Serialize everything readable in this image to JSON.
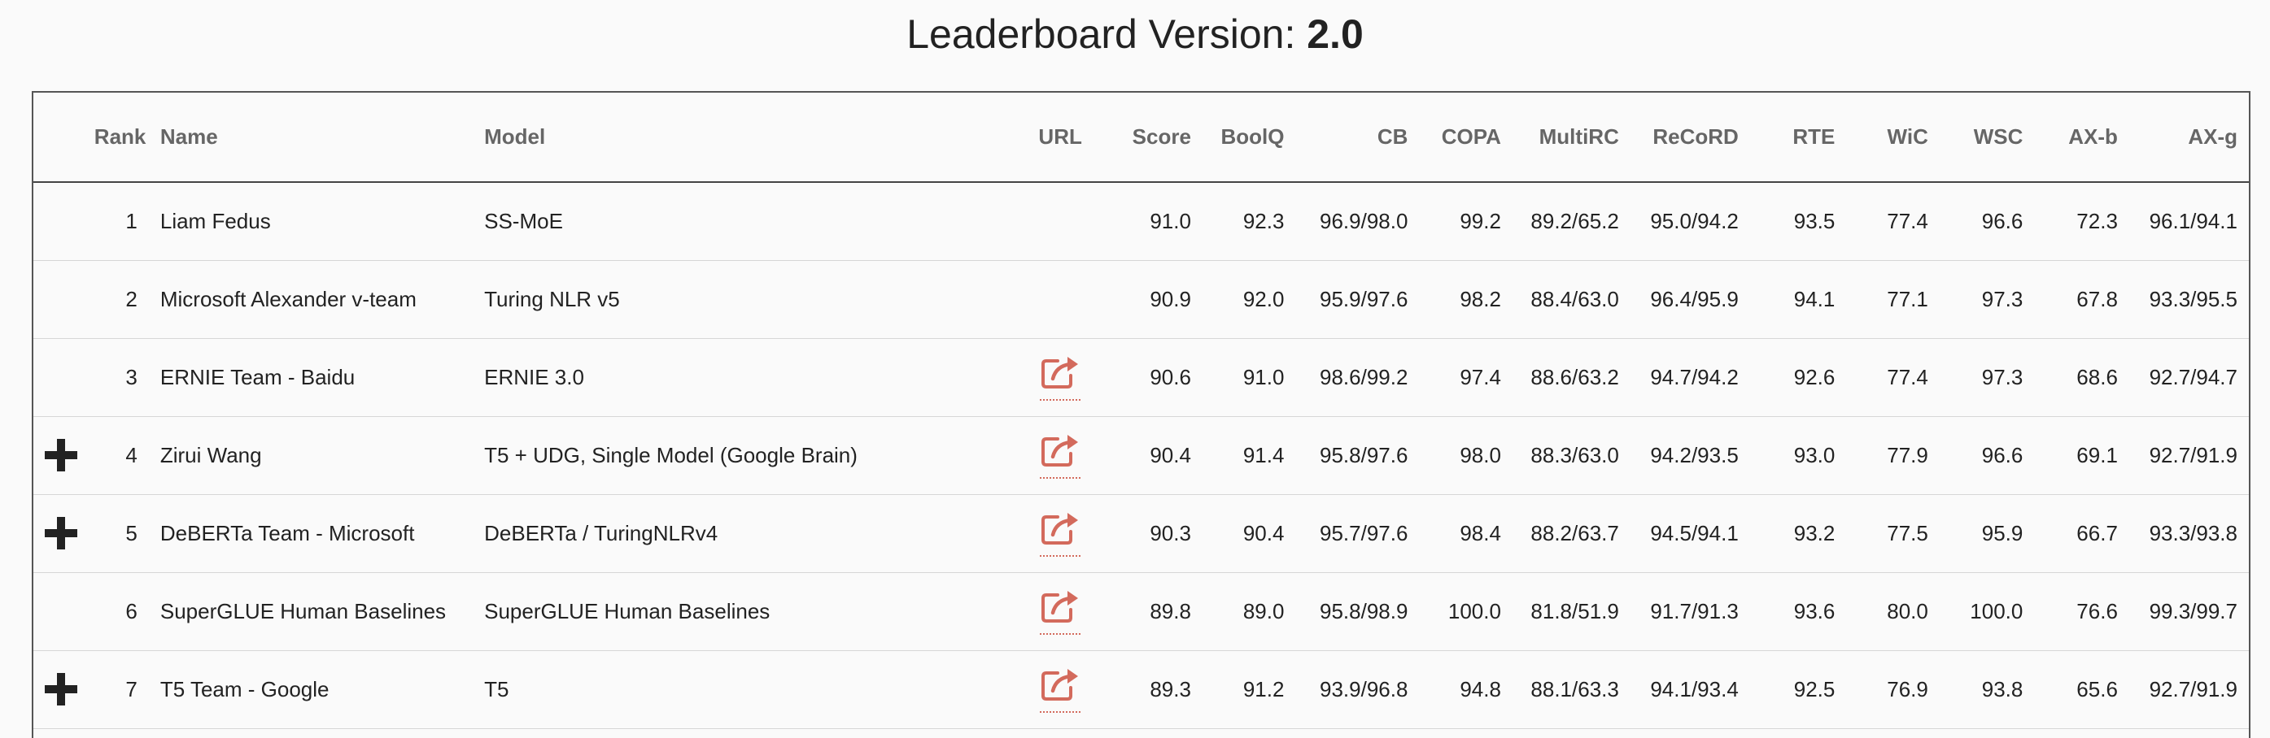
{
  "header": {
    "title_prefix": "Leaderboard Version: ",
    "version": "2.0"
  },
  "columns": {
    "rank": "Rank",
    "name": "Name",
    "model": "Model",
    "url": "URL",
    "score": "Score",
    "boolq": "BoolQ",
    "cb": "CB",
    "copa": "COPA",
    "multirc": "MultiRC",
    "record": "ReCoRD",
    "rte": "RTE",
    "wic": "WiC",
    "wsc": "WSC",
    "axb": "AX-b",
    "axg": "AX-g"
  },
  "rows": [
    {
      "expand": false,
      "rank": "1",
      "name": "Liam Fedus",
      "model": "SS-MoE",
      "has_url": false,
      "score": "91.0",
      "boolq": "92.3",
      "cb": "96.9/98.0",
      "copa": "99.2",
      "multirc": "89.2/65.2",
      "record": "95.0/94.2",
      "rte": "93.5",
      "wic": "77.4",
      "wsc": "96.6",
      "axb": "72.3",
      "axg": "96.1/94.1"
    },
    {
      "expand": false,
      "rank": "2",
      "name": "Microsoft Alexander v-team",
      "model": "Turing NLR v5",
      "has_url": false,
      "score": "90.9",
      "boolq": "92.0",
      "cb": "95.9/97.6",
      "copa": "98.2",
      "multirc": "88.4/63.0",
      "record": "96.4/95.9",
      "rte": "94.1",
      "wic": "77.1",
      "wsc": "97.3",
      "axb": "67.8",
      "axg": "93.3/95.5"
    },
    {
      "expand": false,
      "rank": "3",
      "name": "ERNIE Team - Baidu",
      "model": "ERNIE 3.0",
      "has_url": true,
      "score": "90.6",
      "boolq": "91.0",
      "cb": "98.6/99.2",
      "copa": "97.4",
      "multirc": "88.6/63.2",
      "record": "94.7/94.2",
      "rte": "92.6",
      "wic": "77.4",
      "wsc": "97.3",
      "axb": "68.6",
      "axg": "92.7/94.7"
    },
    {
      "expand": true,
      "rank": "4",
      "name": "Zirui Wang",
      "model": "T5 + UDG, Single Model (Google Brain)",
      "has_url": true,
      "score": "90.4",
      "boolq": "91.4",
      "cb": "95.8/97.6",
      "copa": "98.0",
      "multirc": "88.3/63.0",
      "record": "94.2/93.5",
      "rte": "93.0",
      "wic": "77.9",
      "wsc": "96.6",
      "axb": "69.1",
      "axg": "92.7/91.9"
    },
    {
      "expand": true,
      "rank": "5",
      "name": "DeBERTa Team - Microsoft",
      "model": "DeBERTa / TuringNLRv4",
      "has_url": true,
      "score": "90.3",
      "boolq": "90.4",
      "cb": "95.7/97.6",
      "copa": "98.4",
      "multirc": "88.2/63.7",
      "record": "94.5/94.1",
      "rte": "93.2",
      "wic": "77.5",
      "wsc": "95.9",
      "axb": "66.7",
      "axg": "93.3/93.8"
    },
    {
      "expand": false,
      "rank": "6",
      "name": "SuperGLUE Human Baselines",
      "model": "SuperGLUE Human Baselines",
      "has_url": true,
      "score": "89.8",
      "boolq": "89.0",
      "cb": "95.8/98.9",
      "copa": "100.0",
      "multirc": "81.8/51.9",
      "record": "91.7/91.3",
      "rte": "93.6",
      "wic": "80.0",
      "wsc": "100.0",
      "axb": "76.6",
      "axg": "99.3/99.7"
    },
    {
      "expand": true,
      "rank": "7",
      "name": "T5 Team - Google",
      "model": "T5",
      "has_url": true,
      "score": "89.3",
      "boolq": "91.2",
      "cb": "93.9/96.8",
      "copa": "94.8",
      "multirc": "88.1/63.3",
      "record": "94.1/93.4",
      "rte": "92.5",
      "wic": "76.9",
      "wsc": "93.8",
      "axb": "65.6",
      "axg": "92.7/91.9"
    }
  ],
  "icons": {
    "expand": "plus-icon",
    "url": "external-link-icon",
    "url_color": "#d36a5c"
  }
}
